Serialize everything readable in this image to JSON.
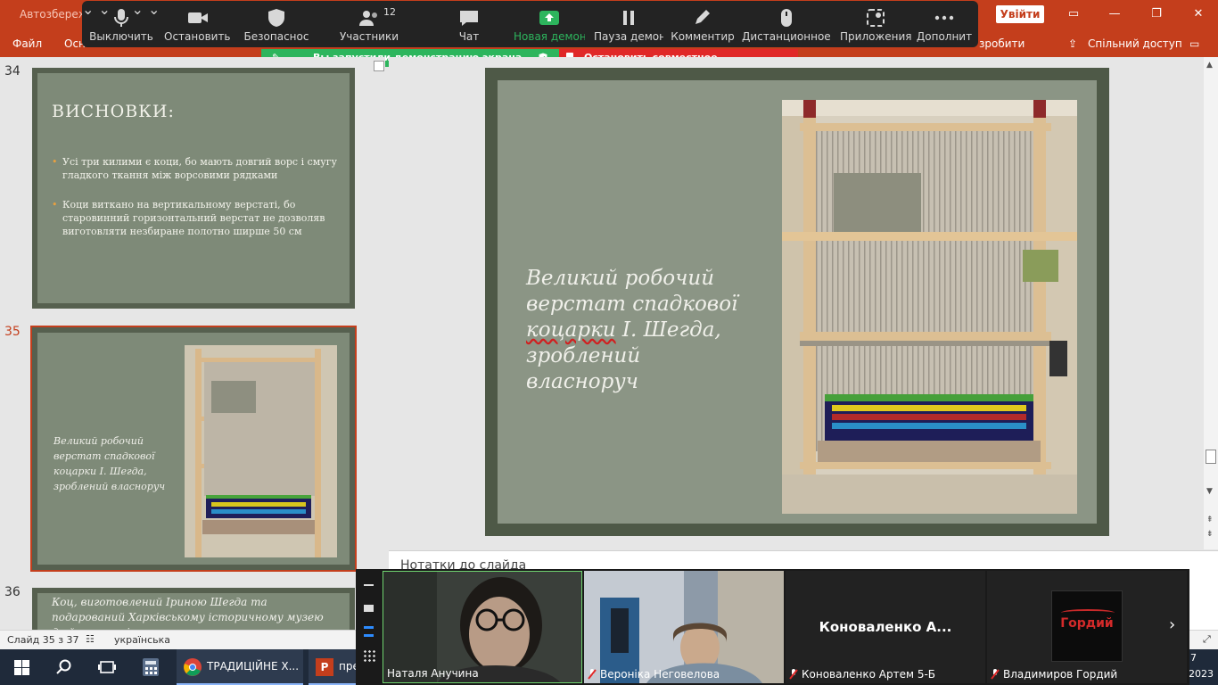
{
  "ppt": {
    "autosave": "Автозбереж",
    "signin": "Увійти",
    "tabs": {
      "file": "Файл",
      "main": "Осн",
      "tell_me": "зробити",
      "share": "Спільний доступ"
    }
  },
  "zoom_toolbar": {
    "mute": "Выключить",
    "stop_video": "Остановить в",
    "security": "Безопаснос",
    "participants": "Участники",
    "participants_count": "12",
    "chat": "Чат",
    "new_share": "Новая демон",
    "pause_share": "Пауза демон",
    "annotate": "Комментир",
    "remote_control": "Дистанционное у",
    "apps": "Приложения",
    "more": "Дополнит"
  },
  "share_banner": {
    "status": "Вы запустили демонстрацию экрана",
    "stop": "Остановить совместное использование"
  },
  "thumbnails": [
    {
      "number": "34",
      "title": "ВИСНОВКИ:",
      "bullets": [
        "Усі три килими є коци, бо мають довгий ворс і смугу гладкого ткання між ворсовими рядками",
        "Коци виткано на вертикальному верстаті, бо старовинний горизонтальний верстат не дозволяв виготовляти незбиране полотно ширше 50 см"
      ]
    },
    {
      "number": "35",
      "caption": "Великий робочий верстат спадкової коцарки І. Шегда, зроблений власноруч"
    },
    {
      "number": "36",
      "caption": "Коц, виготовлений Іриною Шегда та подарований Харківському історичному музею до його сторіччя"
    }
  ],
  "slide": {
    "line1": "Великий робочий",
    "line2": "верстат спадкової",
    "line3a": "коцарки",
    "line3b": " І. Шегда,",
    "line4": "зроблений власноруч"
  },
  "notes_label": "Нотатки до слайда",
  "status": {
    "slide": "Слайд 35 з 37",
    "language": "українська"
  },
  "taskbar": {
    "chrome": "ТРАДИЦІЙНЕ Х...",
    "ppt": "пре",
    "clock_a": "7",
    "clock_b": "2023"
  },
  "gallery": [
    {
      "name": "Наталя Анучина"
    },
    {
      "name": "Вероніка Неговелова"
    },
    {
      "name": "Коноваленко Артем 5-Б",
      "display": "Коноваленко  А..."
    },
    {
      "name": "Владимиров Гордий",
      "avatar_text": "Гордий"
    }
  ],
  "colors": {
    "ppt_red": "#c43e1c",
    "zoom_green": "#2db55d",
    "zoom_red": "#e02828",
    "slide_green": "#8b9585"
  }
}
